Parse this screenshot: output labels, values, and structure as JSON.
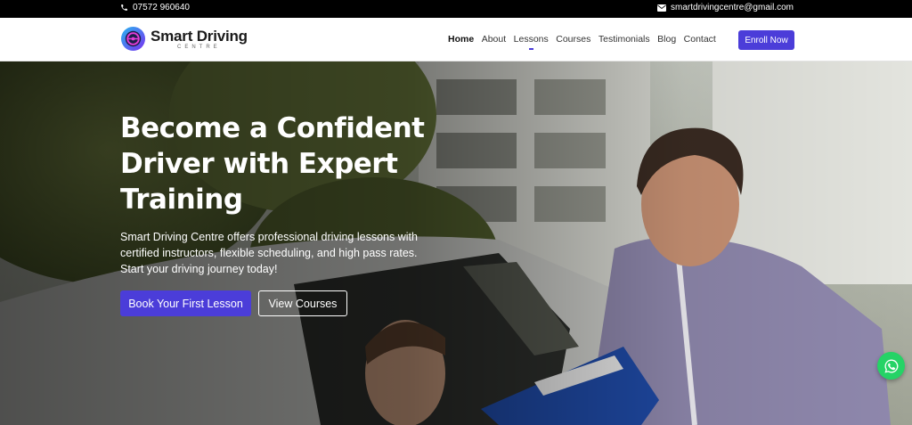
{
  "topbar": {
    "phone": "07572 960640",
    "email": "smartdrivingcentre@gmail.com",
    "phone_icon": "phone-icon",
    "email_icon": "envelope-icon"
  },
  "header": {
    "logo_title": "Smart Driving",
    "logo_subtitle": "CENTRE",
    "logo_icon": "steering-wheel-icon",
    "nav": [
      "Home",
      "About",
      "Lessons",
      "Courses",
      "Testimonials",
      "Blog",
      "Contact"
    ],
    "active_nav": "Home",
    "enroll_label": "Enroll Now"
  },
  "hero": {
    "title": "Become a Confident Driver with Expert Training",
    "description": "Smart Driving Centre offers professional driving lessons with certified instructors, flexible scheduling, and high pass rates. Start your driving journey today!",
    "primary_button": "Book Your First Lesson",
    "secondary_button": "View Courses"
  },
  "floating": {
    "whatsapp_icon": "whatsapp-icon"
  },
  "colors": {
    "accent": "#4b3dd9",
    "topbar_bg": "#000000",
    "whatsapp": "#25d366"
  }
}
